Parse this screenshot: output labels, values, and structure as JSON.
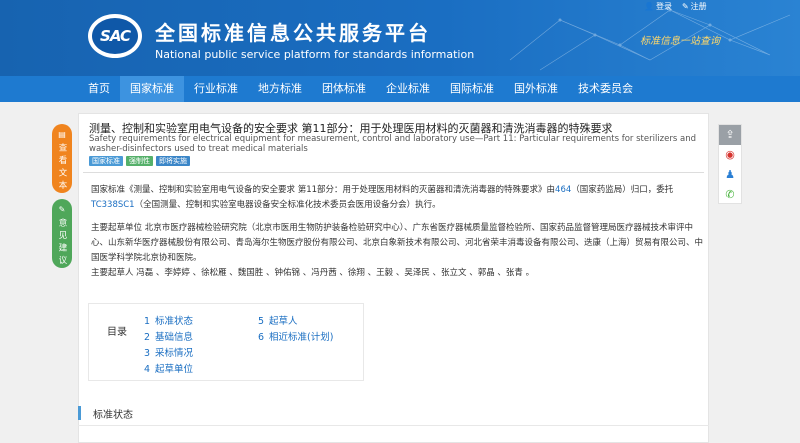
{
  "header": {
    "logo_text": "SAC",
    "title": "全国标准信息公共服务平台",
    "subtitle": "National public service platform  for standards information",
    "slogan": "标准信息一站查询",
    "login_links": [
      "登录",
      "注册"
    ]
  },
  "nav": {
    "items": [
      "首页",
      "国家标准",
      "行业标准",
      "地方标准",
      "团体标准",
      "企业标准",
      "国际标准",
      "国外标准",
      "技术委员会"
    ],
    "active_index": 1
  },
  "side_tabs": {
    "view_text": "查看文本",
    "feedback": "意见建议"
  },
  "standard": {
    "title": "测量、控制和实验室用电气设备的安全要求 第11部分：用于处理医用材料的灭菌器和清洗消毒器的特殊要求",
    "title_en": "Safety requirements for electrical equipment for measurement, control and laboratory use—Part 11: Particular requirements for sterilizers and washer-disinfectors used to treat medical materials",
    "tags": [
      "国家标准",
      "强制性",
      "即将实施"
    ]
  },
  "paragraphs": {
    "p1_a": "国家标准《测量、控制和实验室用电气设备的安全要求 第11部分：用于处理医用材料的灭菌器和清洗消毒器的特殊要求》由",
    "p1_link1": "464",
    "p1_b": "（国家药监局）归口，委托",
    "p1_link2": "TC338SC1",
    "p1_c": "（全国测量、控制和实验室电器设备安全标准化技术委员会医用设备分会）执行。",
    "p2": "主要起草单位 北京市医疗器械检验研究院（北京市医用生物防护装备检验研究中心）、广东省医疗器械质量监督检验所、国家药品监督管理局医疗器械技术审评中心、山东新华医疗器械股份有限公司、青岛海尔生物医疗股份有限公司、北京白象新技术有限公司、河北省荣丰消毒设备有限公司、迭康（上海）贸易有限公司、中国医学科学院北京协和医院。",
    "p3": "主要起草人 冯磊 、李婷婷 、徐松雁 、魏国胜 、钟佑锦 、冯丹茜 、徐翔 、王毅 、吴泽民 、张立文 、郭晶 、张青 。"
  },
  "toc": {
    "label": "目录",
    "items": [
      {
        "num": "1",
        "text": "标准状态"
      },
      {
        "num": "2",
        "text": "基础信息"
      },
      {
        "num": "3",
        "text": "采标情况"
      },
      {
        "num": "4",
        "text": "起草单位"
      },
      {
        "num": "5",
        "text": "起草人"
      },
      {
        "num": "6",
        "text": "相近标准(计划)"
      }
    ]
  },
  "section": {
    "title": "标准状态"
  },
  "colors": {
    "header_blue": "#1763b0",
    "nav_blue": "#1e7ad0",
    "link_blue": "#1a6ec2",
    "orange_tab": "#f0841e",
    "green_tab": "#4fa75a"
  }
}
